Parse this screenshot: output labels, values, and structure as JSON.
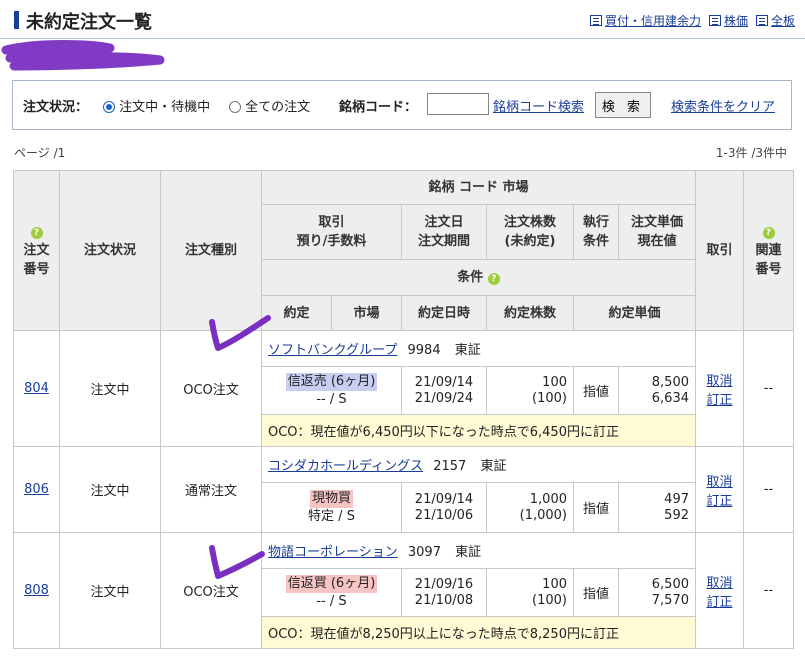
{
  "header": {
    "title": "未約定注文一覧",
    "links": [
      "買付・信用建余力",
      "株価",
      "全板"
    ]
  },
  "filter": {
    "status_label": "注文状況：",
    "opt_active": "注文中・待機中",
    "opt_all": "全ての注文",
    "code_label": "銘柄コード：",
    "code_value": "",
    "code_search_link": "銘柄コード検索",
    "search_button": "検 索",
    "clear_link": "検索条件をクリア"
  },
  "paging": {
    "page": "ページ /1",
    "count": "1-3件 /3件中"
  },
  "columns": {
    "order_no_1": "注文",
    "order_no_2": "番号",
    "status": "注文状況",
    "kind": "注文種別",
    "stock": "銘柄 コード 市場",
    "trade_1": "取引",
    "trade_2": "預り/手数料",
    "date_1": "注文日",
    "date_2": "注文期間",
    "qty_1": "注文株数",
    "qty_2": "(未約定)",
    "exec_1": "執行",
    "exec_2": "条件",
    "price_1": "注文単価",
    "price_2": "現在値",
    "torihiki": "取引",
    "related_1": "関連",
    "related_2": "番号",
    "condition": "条件",
    "sub_fill": "約定",
    "sub_market": "市場",
    "sub_fill_date": "約定日時",
    "sub_fill_qty": "約定株数",
    "sub_fill_price": "約定単価"
  },
  "orders": [
    {
      "no": "804",
      "status": "注文中",
      "kind": "OCO注文",
      "name": "ソフトバンクグループ",
      "code": "9984",
      "market": "東証",
      "trade": "信返売 (6ヶ月)",
      "account": "-- / S",
      "date": "21/09/14",
      "period": "21/09/24",
      "qty": "100",
      "unfilled": "(100)",
      "exec": "指値",
      "price": "8,500",
      "current": "6,634",
      "cancel": "取消",
      "edit": "訂正",
      "related": "--",
      "cond": "OCO：現在値が6,450円以下になった時点で6,450円に訂正"
    },
    {
      "no": "806",
      "status": "注文中",
      "kind": "通常注文",
      "name": "コシダカホールディングス",
      "code": "2157",
      "market": "東証",
      "trade": "現物買",
      "account": "特定 / S",
      "date": "21/09/14",
      "period": "21/10/06",
      "qty": "1,000",
      "unfilled": "(1,000)",
      "exec": "指値",
      "price": "497",
      "current": "592",
      "cancel": "取消",
      "edit": "訂正",
      "related": "--",
      "cond": ""
    },
    {
      "no": "808",
      "status": "注文中",
      "kind": "OCO注文",
      "name": "物語コーポレーション",
      "code": "3097",
      "market": "東証",
      "trade": "信返買 (6ヶ月)",
      "account": "-- / S",
      "date": "21/09/16",
      "period": "21/10/08",
      "qty": "100",
      "unfilled": "(100)",
      "exec": "指値",
      "price": "6,500",
      "current": "7,570",
      "cancel": "取消",
      "edit": "訂正",
      "related": "--",
      "cond": "OCO：現在値が8,250円以上になった時点で8,250円に訂正"
    }
  ]
}
